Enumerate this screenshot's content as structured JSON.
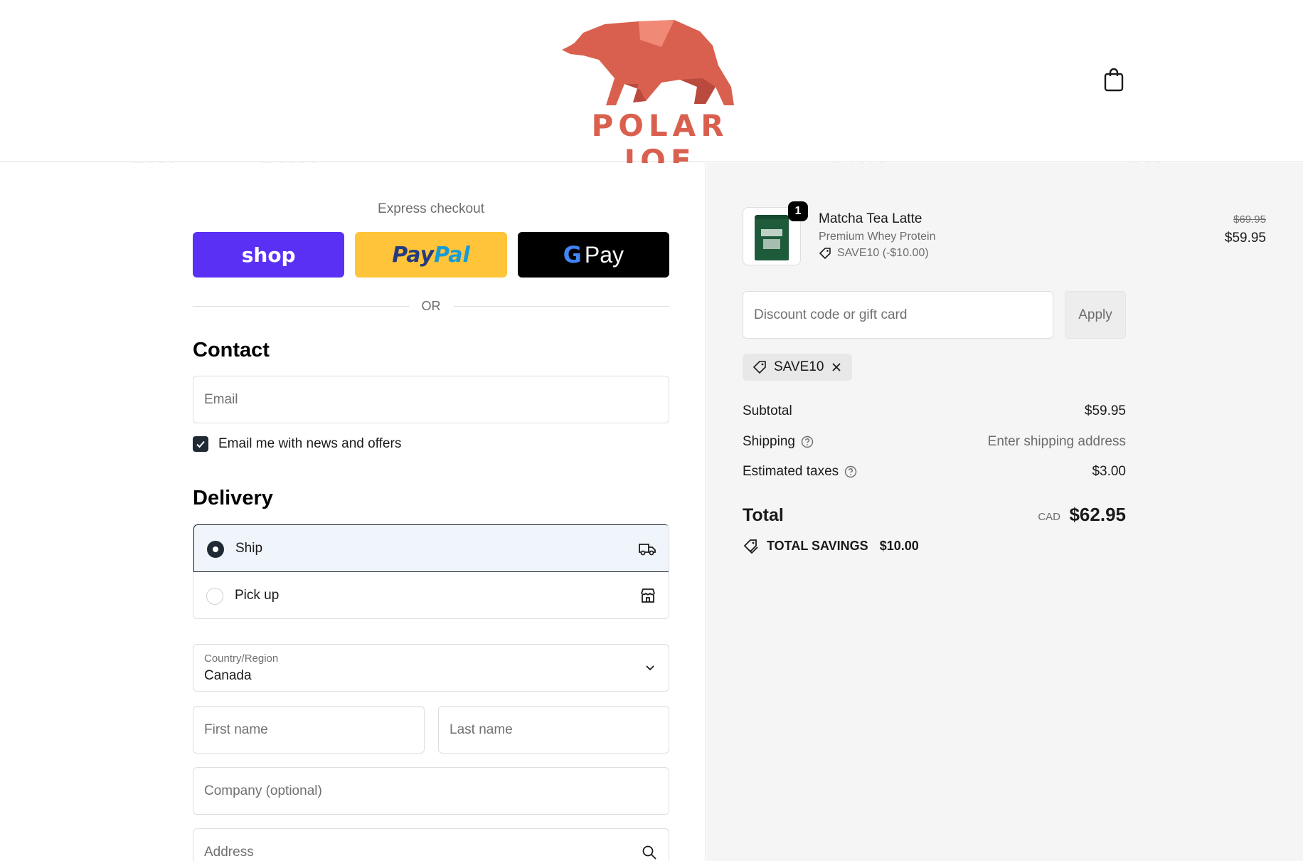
{
  "header": {
    "brand_name": "POLAR JOE",
    "cart_icon": "shopping-bag-icon"
  },
  "express": {
    "title": "Express checkout",
    "shop_label": "shop",
    "paypal_label_a": "Pay",
    "paypal_label_b": "Pal",
    "gpay_g": "G",
    "gpay_label": "Pay",
    "or_label": "OR"
  },
  "contact": {
    "heading": "Contact",
    "email_placeholder": "Email",
    "newsletter_label": "Email me with news and offers",
    "newsletter_checked": true
  },
  "delivery": {
    "heading": "Delivery",
    "options": [
      {
        "label": "Ship",
        "selected": true,
        "icon": "truck-icon"
      },
      {
        "label": "Pick up",
        "selected": false,
        "icon": "store-icon"
      }
    ],
    "country_label": "Country/Region",
    "country_value": "Canada",
    "first_name_placeholder": "First name",
    "last_name_placeholder": "Last name",
    "company_placeholder": "Company (optional)",
    "address_placeholder": "Address"
  },
  "summary": {
    "item": {
      "name": "Matcha Tea Latte",
      "variant": "Premium Whey Protein",
      "discount": "SAVE10 (-$10.00)",
      "quantity": "1",
      "price_original": "$69.95",
      "price_current": "$59.95"
    },
    "discount_placeholder": "Discount code or gift card",
    "apply_label": "Apply",
    "applied_code": "SAVE10",
    "subtotal_label": "Subtotal",
    "subtotal_value": "$59.95",
    "shipping_label": "Shipping",
    "shipping_value": "Enter shipping address",
    "taxes_label": "Estimated taxes",
    "taxes_value": "$3.00",
    "total_label": "Total",
    "total_currency": "CAD",
    "total_value": "$62.95",
    "savings_label": "TOTAL SAVINGS",
    "savings_value": "$10.00"
  },
  "colors": {
    "brand": "#d9604f",
    "shop_pay": "#5a31f4",
    "paypal": "#ffc439",
    "primary_dark": "#1f2a35"
  }
}
